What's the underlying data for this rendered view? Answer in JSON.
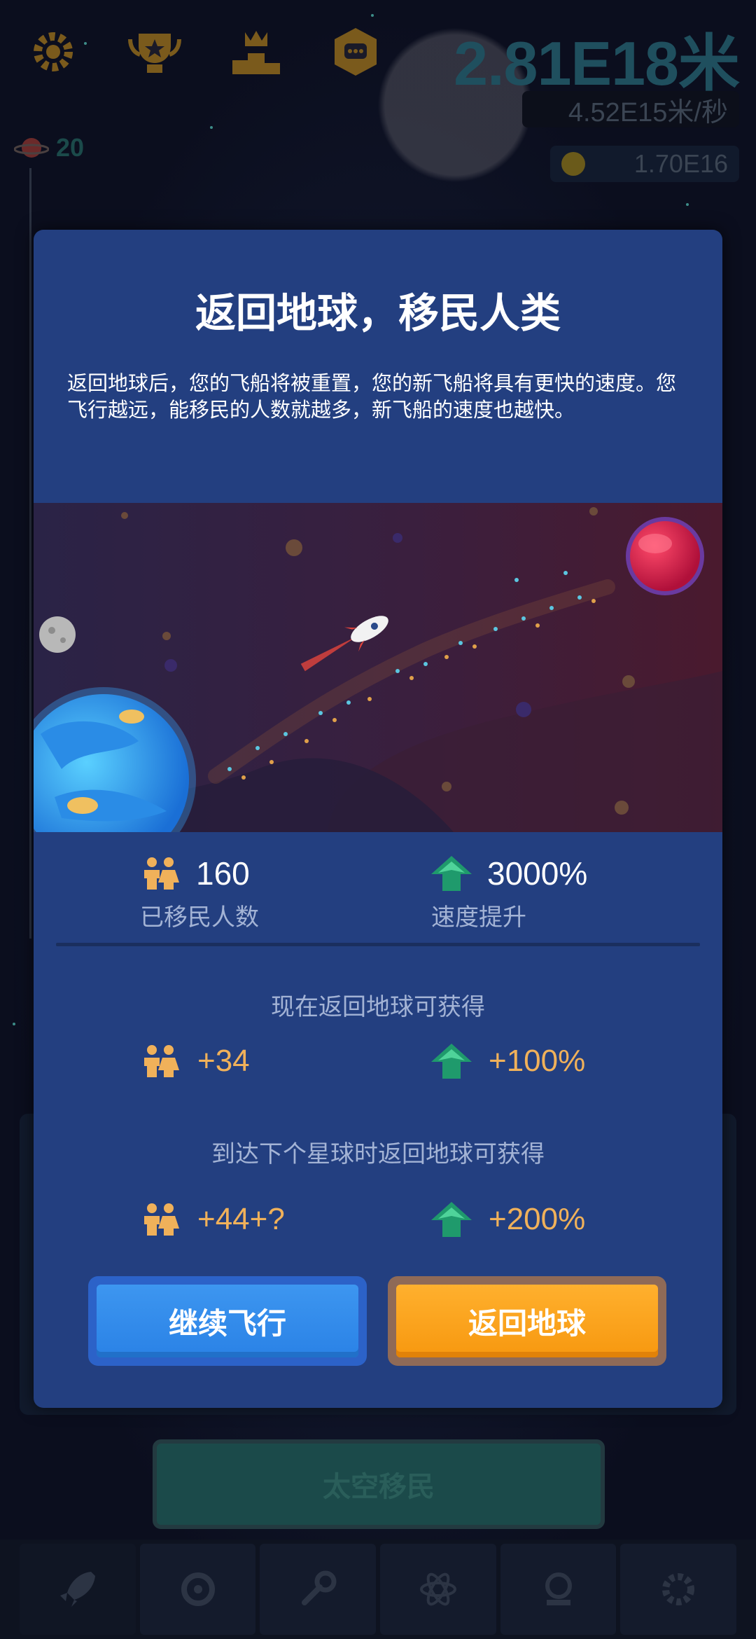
{
  "hud": {
    "distance": "2.81E18米",
    "speed": "4.52E15米/秒",
    "coins": "1.70E16",
    "planet_count": "20"
  },
  "background": {
    "bottom_button_label": "太空移民"
  },
  "dialog": {
    "title": "返回地球，移民人类",
    "description": "返回地球后，您的飞船将被重置，您的新飞船将具有更快的速度。您飞行越远，能移民的人数就越多，新飞船的速度也越快。",
    "current_stats": {
      "migrants_value": "160",
      "migrants_label": "已移民人数",
      "speed_value": "3000%",
      "speed_label": "速度提升"
    },
    "now_section_title": "现在返回地球可获得",
    "now_gain": {
      "migrants": "+34",
      "speed": "+100%"
    },
    "next_section_title": "到达下个星球时返回地球可获得",
    "next_gain": {
      "migrants": "+44+?",
      "speed": "+200%"
    },
    "continue_button": "继续飞行",
    "return_button": "返回地球"
  },
  "colors": {
    "dialog_bg": "#233f80",
    "value_orange": "#f0b15a",
    "label_blue": "#a3b3d5",
    "continue_button": "#3d96f0",
    "return_button": "#f7980f"
  }
}
